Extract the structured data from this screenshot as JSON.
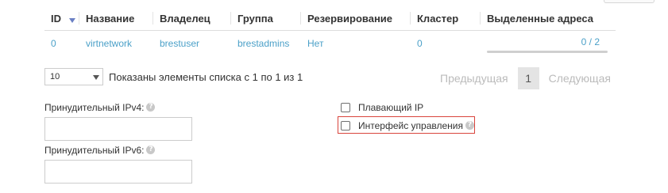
{
  "table": {
    "columns": [
      "ID",
      "Название",
      "Владелец",
      "Группа",
      "Резервирование",
      "Кластер",
      "Выделенные адреса"
    ],
    "rows": [
      {
        "id": "0",
        "name": "virtnetwork",
        "owner": "brestuser",
        "group": "brestadmins",
        "reservation": "Нет",
        "cluster": "0",
        "leases": "0 / 2",
        "leases_fraction": 0
      }
    ],
    "sort_column": "ID",
    "sort_direction": "desc"
  },
  "pagination": {
    "page_size": "10",
    "info": "Показаны элементы списка с 1 по 1 из 1",
    "previous": "Предыдущая",
    "current_page": "1",
    "next": "Следующая"
  },
  "form": {
    "ipv4_label": "Принудительный IPv4:",
    "ipv4_value": "",
    "ipv6_label": "Принудительный IPv6:",
    "ipv6_value": "",
    "floating_ip_label": "Плавающий IP",
    "floating_ip_checked": false,
    "mgmt_interface_label": "Интерфейс управления",
    "mgmt_interface_checked": false,
    "help_glyph": "?"
  },
  "colors": {
    "link": "#4ba0c8",
    "highlight": "#d9443c",
    "sort_arrow": "#6a7fc4"
  }
}
